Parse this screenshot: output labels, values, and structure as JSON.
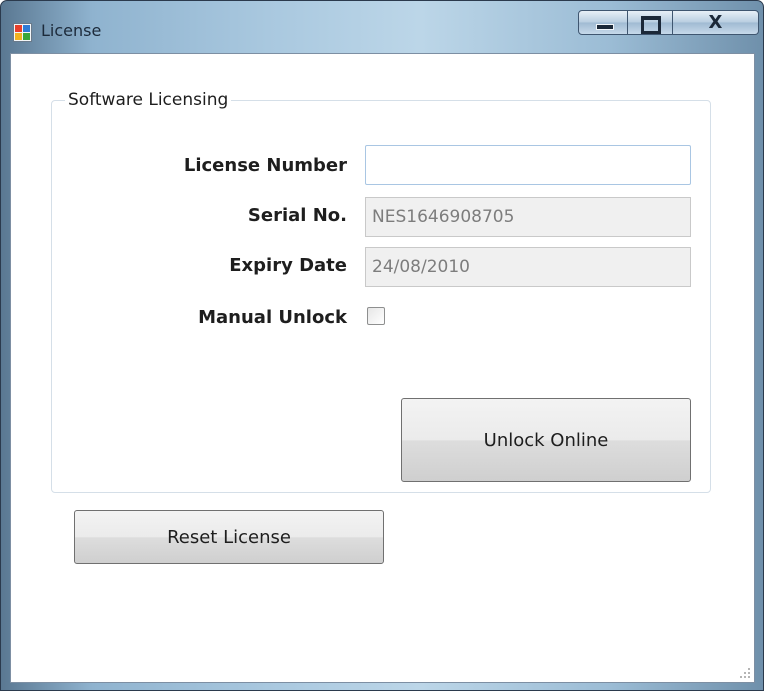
{
  "window": {
    "title": "License"
  },
  "group": {
    "legend": "Software Licensing"
  },
  "form": {
    "license_number": {
      "label": "License Number",
      "value": ""
    },
    "serial_no": {
      "label": "Serial No.",
      "value": "NES1646908705"
    },
    "expiry_date": {
      "label": "Expiry Date",
      "value": "24/08/2010"
    },
    "manual_unlock": {
      "label": "Manual Unlock",
      "checked": false
    }
  },
  "buttons": {
    "unlock_online": "Unlock Online",
    "reset_license": "Reset License",
    "close_glyph": "X"
  },
  "icons": [
    "app-icon",
    "minimize-icon",
    "maximize-icon",
    "close-icon",
    "resize-grip-icon"
  ]
}
